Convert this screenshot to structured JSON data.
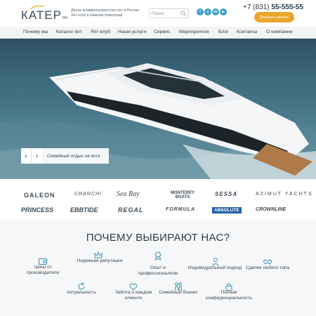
{
  "header": {
    "logo_word": "КАТЕР",
    "logo_sub": "НН",
    "tagline": "Дилер всемирноизвестных яхт в России Яхт-клуб в Нижнем Новгороде",
    "search_placeholder": "Поиск",
    "socials": [
      {
        "icon": "facebook-icon",
        "glyph": "f"
      },
      {
        "icon": "instagram-icon",
        "glyph": "◎"
      },
      {
        "icon": "vk-icon",
        "glyph": "vk"
      },
      {
        "icon": "youtube-icon",
        "glyph": "▶"
      }
    ],
    "phone_prefix": "+7 (831) ",
    "phone_number": "55-555-55",
    "call_button": "Заказать звонок"
  },
  "nav": {
    "items": [
      "Почему мы",
      "Каталог яхт",
      "Яхт-клуб",
      "Наши услуги",
      "Сервис",
      "Мероприятия",
      "Блог",
      "Контакты",
      "О компании"
    ]
  },
  "hero": {
    "caption": "Семейный отдых на яхте",
    "prev_glyph": "‹",
    "next_glyph": "›"
  },
  "brands": {
    "row1": [
      "GALEON",
      "CRANCHI",
      "Sea Ray",
      "MONTEREY BOATS",
      "SESSA",
      "AZIMUT YACHTS"
    ],
    "row2": [
      "PRINCESS",
      "EBBTIDE",
      "REGAL",
      "FORMULA",
      "ABSOLUTE",
      "CROWNLINE"
    ]
  },
  "why": {
    "title": "ПОЧЕМУ ВЫБИРАЮТ НАС?",
    "features": [
      {
        "label": "Цены от производителя",
        "icon": "wallet-icon"
      },
      {
        "label": "Надежная репутация",
        "icon": "crown-icon"
      },
      {
        "label": "Опыт и профессионализм",
        "icon": "badge-icon"
      },
      {
        "label": "Индивидуальный подход",
        "icon": "person-icon"
      },
      {
        "label": "Сделки любого типа",
        "icon": "handshake-icon"
      },
      {
        "label": "Актуальность",
        "icon": "refresh-icon"
      },
      {
        "label": "Забота о каждом клиенте",
        "icon": "care-icon"
      },
      {
        "label": "Семейный бизнес",
        "icon": "family-icon"
      },
      {
        "label": "Полная конфиденциальность",
        "icon": "lock-icon"
      }
    ]
  },
  "colors": {
    "accent": "#e8a72a",
    "social": "#3ba0c9",
    "icon": "#3b8fb5",
    "text": "#2f3b45"
  }
}
